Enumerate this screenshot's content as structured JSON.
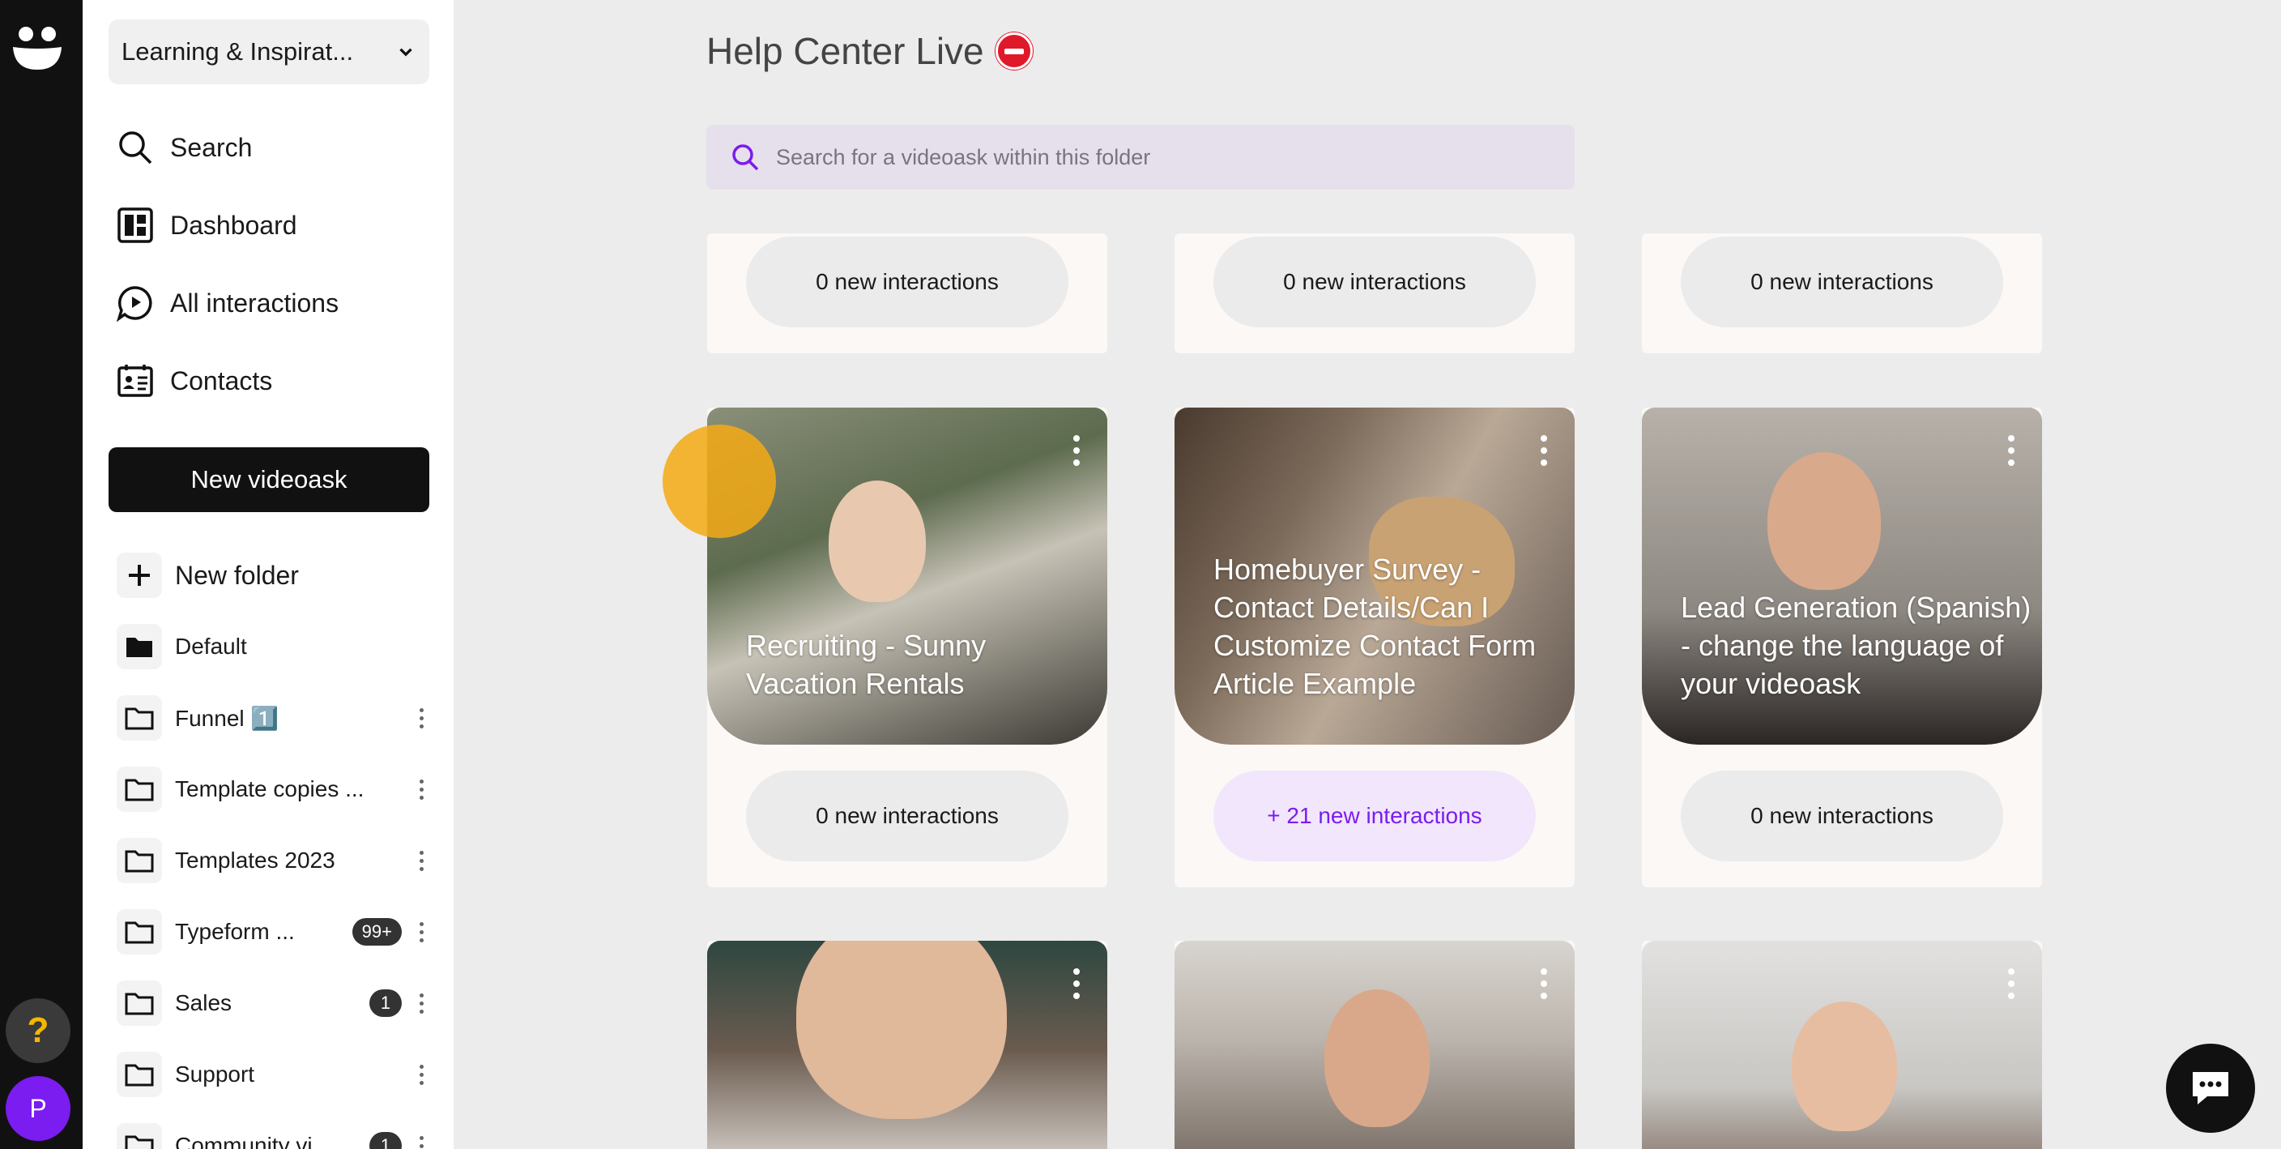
{
  "org": {
    "name": "Learning & Inspirat..."
  },
  "nav": [
    {
      "label": "Search",
      "icon": "search-icon"
    },
    {
      "label": "Dashboard",
      "icon": "dashboard-icon"
    },
    {
      "label": "All interactions",
      "icon": "interactions-icon"
    },
    {
      "label": "Contacts",
      "icon": "contacts-icon"
    }
  ],
  "new_videoask": "New videoask",
  "new_folder": "New folder",
  "folders": [
    {
      "name": "Default",
      "badge": ""
    },
    {
      "name": "Funnel 1️⃣",
      "badge": ""
    },
    {
      "name": "Template copies ...",
      "badge": ""
    },
    {
      "name": "Templates 2023",
      "badge": ""
    },
    {
      "name": "Typeform ...",
      "badge": "99+"
    },
    {
      "name": "Sales",
      "badge": "1"
    },
    {
      "name": "Support",
      "badge": ""
    },
    {
      "name": "Community vi...",
      "badge": "1"
    }
  ],
  "page": {
    "title": "Help Center Live",
    "search_placeholder": "Search for a videoask within this folder"
  },
  "cards_top": [
    {
      "interactions": "0 new interactions"
    },
    {
      "interactions": "0 new interactions"
    },
    {
      "interactions": "0 new interactions"
    }
  ],
  "cards_mid": [
    {
      "title": "Recruiting - Sunny Vacation Rentals",
      "interactions": "0 new interactions",
      "highlight": false
    },
    {
      "title": "Homebuyer Survey - Contact Details/Can I Customize Contact Form Article Example",
      "interactions": "+ 21 new interactions",
      "highlight": true
    },
    {
      "title": "Lead Generation (Spanish) - change the language of your videoask",
      "interactions": "0 new interactions",
      "highlight": false
    }
  ],
  "user": {
    "initial": "P"
  },
  "help": {
    "label": "?"
  },
  "colors": {
    "accent": "#7b1cf0",
    "rail": "#111111",
    "help": "#f5b800"
  }
}
